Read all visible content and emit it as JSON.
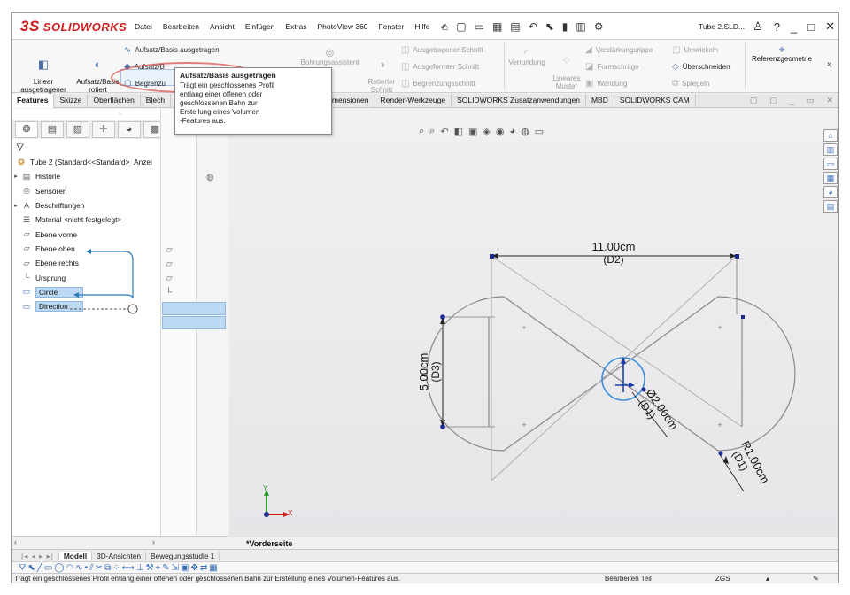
{
  "app": {
    "logo_ds": "3S",
    "logo_text": "SOLIDWORKS"
  },
  "menu": [
    "Datei",
    "Bearbeiten",
    "Ansicht",
    "Einfügen",
    "Extras",
    "PhotoView 360",
    "Fenster",
    "Hilfe"
  ],
  "document_title": "Tube 2.SLD...",
  "window_controls": [
    "?",
    "_",
    "□",
    "✕"
  ],
  "ribbon": {
    "linear": "Linear\nausgetragener\nAufsatz",
    "rotiert": "Aufsatz/Basis\nrotiert",
    "ausgetragen": "Aufsatz/Basis ausgetragen",
    "aufsatz_b": "Aufsatz/B",
    "begrenzung_small": "Begrenzu",
    "bohrungsassistent": "Bohrungsassistent",
    "rotierter_schnitt": "Rotierter\nSchnitt",
    "ausgetragener_schnitt": "Ausgetragener Schnitt",
    "ausgeformter_schnitt": "Ausgeformter Schnitt",
    "begrenzungsschnitt": "Begrenzungsschnitt",
    "verrundung": "Verrundung",
    "lineares_muster": "Lineares\nMuster",
    "verstaerkungsrippe": "Verstärkungsrippe",
    "formschraege": "Formschräge",
    "wandung": "Wandung",
    "umwickeln": "Umwickeln",
    "ueberschneiden": "Überschneiden",
    "spiegeln": "Spiegeln",
    "referenzgeometrie": "Referenzgeometrie"
  },
  "tabs": [
    "Features",
    "Skizze",
    "Oberflächen",
    "Blech",
    "-Dimensionen",
    "Render-Werkzeuge",
    "SOLIDWORKS Zusatzanwendungen",
    "MBD",
    "SOLIDWORKS CAM"
  ],
  "tooltip": {
    "title": "Aufsatz/Basis ausgetragen",
    "body": "Trägt ein geschlossenes Profil\nentlang einer offenen oder\ngeschlossenen Bahn zur\nErstellung eines Volumen\n-Features aus."
  },
  "tree": {
    "root": "Tube 2  (Standard<<Standard>_Anzei",
    "items": [
      {
        "label": "Historie",
        "expand": "▸",
        "icon": "folder-icon"
      },
      {
        "label": "Sensoren",
        "expand": "",
        "icon": "sensor-icon"
      },
      {
        "label": "Beschriftungen",
        "expand": "▸",
        "icon": "annotation-icon"
      },
      {
        "label": "Material <nicht festgelegt>",
        "expand": "",
        "icon": "material-icon"
      },
      {
        "label": "Ebene vorne",
        "expand": "",
        "icon": "plane-icon"
      },
      {
        "label": "Ebene oben",
        "expand": "",
        "icon": "plane-icon"
      },
      {
        "label": "Ebene rechts",
        "expand": "",
        "icon": "plane-icon"
      },
      {
        "label": "Ursprung",
        "expand": "",
        "icon": "origin-icon"
      },
      {
        "label": "Circle",
        "expand": "",
        "icon": "sketch-icon"
      },
      {
        "label": "Direction",
        "expand": "",
        "icon": "sketch-icon"
      }
    ]
  },
  "sketch": {
    "d2": "11.00cm",
    "d2_tag": "(D2)",
    "d3": "5.00cm",
    "d3_tag": "(D3)",
    "d1_dia": "Ø2.00cm",
    "d1_tag": "(D1)",
    "r1": "R1.00cm",
    "r1_tag": "(D1)",
    "axis_y": "Y",
    "axis_x": "X"
  },
  "view_label": "*Vorderseite",
  "bottom_tabs": [
    "Modell",
    "3D-Ansichten",
    "Bewegungsstudie 1"
  ],
  "status": {
    "message": "Trägt ein geschlossenes Profil entlang einer offenen oder geschlossenen Bahn zur Erstellung eines Volumen-Features aus.",
    "mode": "Bearbeiten Teil",
    "units": "ZGS"
  }
}
